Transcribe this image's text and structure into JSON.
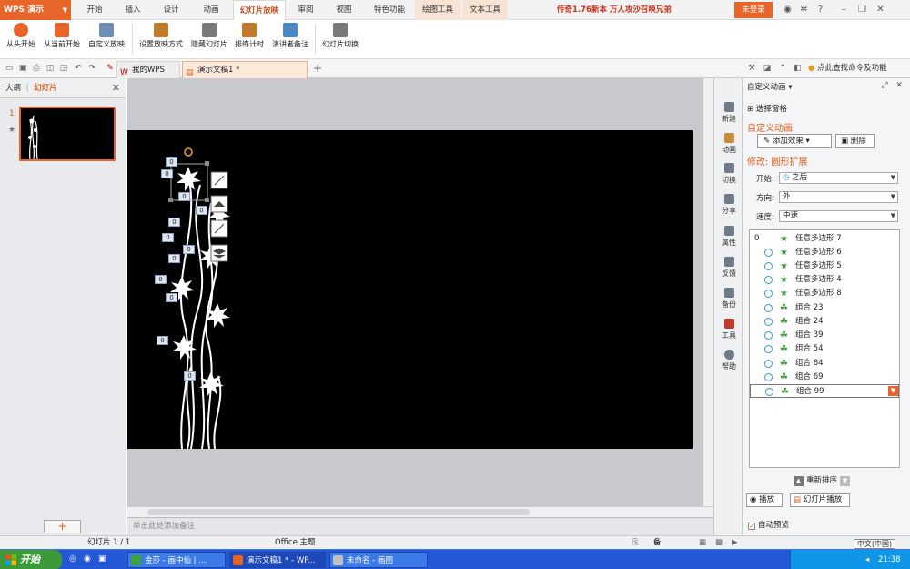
{
  "app": {
    "name": "WPS 演示"
  },
  "menu": {
    "items": [
      {
        "label": "开始"
      },
      {
        "label": "插入"
      },
      {
        "label": "设计"
      },
      {
        "label": "动画"
      },
      {
        "label": "幻灯片放映"
      },
      {
        "label": "审阅"
      },
      {
        "label": "视图"
      },
      {
        "label": "特色功能"
      },
      {
        "label": "绘图工具"
      },
      {
        "label": "文本工具"
      }
    ],
    "promo": "传奇1.76新本 万人攻沙召唤兄弟",
    "login": "未登录"
  },
  "ribbon": {
    "buttons": [
      {
        "label": "从头开始",
        "color": "#e8652a"
      },
      {
        "label": "从当前开始",
        "color": "#e8652a"
      },
      {
        "label": "自定义放映",
        "color": "#6c8fb5"
      },
      {
        "label": "设置放映方式",
        "color": "#c07a2a"
      },
      {
        "label": "隐藏幻灯片",
        "color": "#7a7a7a"
      },
      {
        "label": "排练计时",
        "color": "#c07a2a"
      },
      {
        "label": "演讲者备注",
        "color": "#4a8ac4"
      },
      {
        "label": "幻灯片切换",
        "color": "#7a7a7a"
      }
    ]
  },
  "tabs": {
    "items": [
      {
        "label": "我的WPS"
      },
      {
        "label": "演示文稿1 *"
      }
    ],
    "help": "点此查找命令及功能"
  },
  "left_panel": {
    "tab_outline": "大纲",
    "tab_slides": "幻灯片",
    "slide_number": "1",
    "star": "★",
    "add_button": "+"
  },
  "canvas": {
    "notes_placeholder": "单击此处添加备注",
    "order_tags": [
      "0",
      "0",
      "0",
      "0",
      "0",
      "0",
      "0",
      "0",
      "0",
      "0",
      "0",
      "0"
    ]
  },
  "side_strip": {
    "items": [
      {
        "label": "新建"
      },
      {
        "label": "动画"
      },
      {
        "label": "切换"
      },
      {
        "label": "分享"
      },
      {
        "label": "属性"
      },
      {
        "label": "反馈"
      },
      {
        "label": "备份"
      },
      {
        "label": "工具"
      },
      {
        "label": "帮助"
      }
    ]
  },
  "anim_pane": {
    "title": "自定义动画",
    "select_pane": "选择窗格",
    "section": "自定义动画",
    "add_effect": "添加效果",
    "delete": "删除",
    "modify": "修改: 圆形扩展",
    "start_label": "开始:",
    "start_value": "之后",
    "direction_label": "方向:",
    "direction_value": "外",
    "speed_label": "速度:",
    "speed_value": "中速",
    "list": [
      {
        "index": "0",
        "name": "任意多边形 7"
      },
      {
        "index": "",
        "name": "任意多边形 6"
      },
      {
        "index": "",
        "name": "任意多边形 5"
      },
      {
        "index": "",
        "name": "任意多边形 4"
      },
      {
        "index": "",
        "name": "任意多边形 8"
      },
      {
        "index": "",
        "name": "组合 23"
      },
      {
        "index": "",
        "name": "组合 24"
      },
      {
        "index": "",
        "name": "组合 39"
      },
      {
        "index": "",
        "name": "组合 54"
      },
      {
        "index": "",
        "name": "组合 84"
      },
      {
        "index": "",
        "name": "组合 69"
      },
      {
        "index": "",
        "name": "组合 99"
      }
    ],
    "reorder": "重新排序",
    "play": "播放",
    "slideshow": "幻灯片播放",
    "autopreview": "自动预览"
  },
  "statusbar": {
    "slide_info": "幻灯片 1 / 1",
    "theme": "Office 主题",
    "notes": "备注",
    "zoom": "中文(中国)"
  },
  "taskbar": {
    "start": "开始",
    "tasks": [
      {
        "label": "金莎 - 画中仙 | ...",
        "active": false
      },
      {
        "label": "演示文稿1 * - WP...",
        "active": true
      },
      {
        "label": "未命名 - 画图",
        "active": false
      }
    ],
    "clock": "21:38"
  }
}
